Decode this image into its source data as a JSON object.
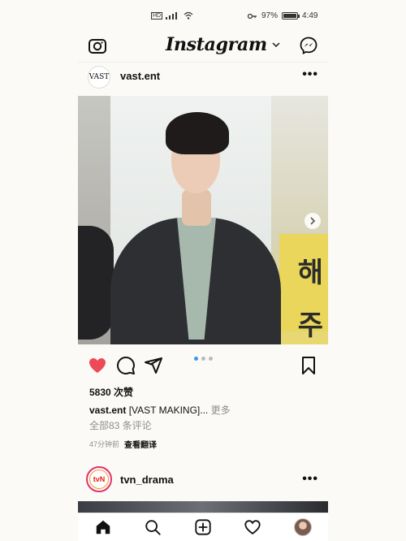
{
  "status_bar": {
    "left_text": "HD",
    "battery_percent": "97%",
    "battery_level": 0.97,
    "time": "4:49"
  },
  "header": {
    "logo": "Instagram",
    "icons": [
      "camera-icon",
      "chevron-down-icon",
      "messenger-icon"
    ]
  },
  "post1": {
    "username": "vast.ent",
    "avatar_text": "VAST",
    "more": "•••",
    "image_text": [
      "해",
      "주"
    ],
    "carousel": {
      "count": 3,
      "active": 0
    },
    "likes": "5830 次赞",
    "caption_user": "vast.ent",
    "caption_text": " [VAST MAKING]... ",
    "caption_more": "更多",
    "comments": "全部83 条评论",
    "time": "47分钟前",
    "translate": "查看翻译"
  },
  "post2": {
    "username": "tvn_drama",
    "avatar_text": "tvN",
    "more": "•••"
  },
  "tab_bar": {
    "icons": [
      "home-icon",
      "search-icon",
      "new-post-icon",
      "activity-heart-icon",
      "profile-avatar"
    ]
  },
  "colors": {
    "like_red": "#ed4956",
    "carousel_active": "#3897f0",
    "background": "#fbfaf6"
  }
}
